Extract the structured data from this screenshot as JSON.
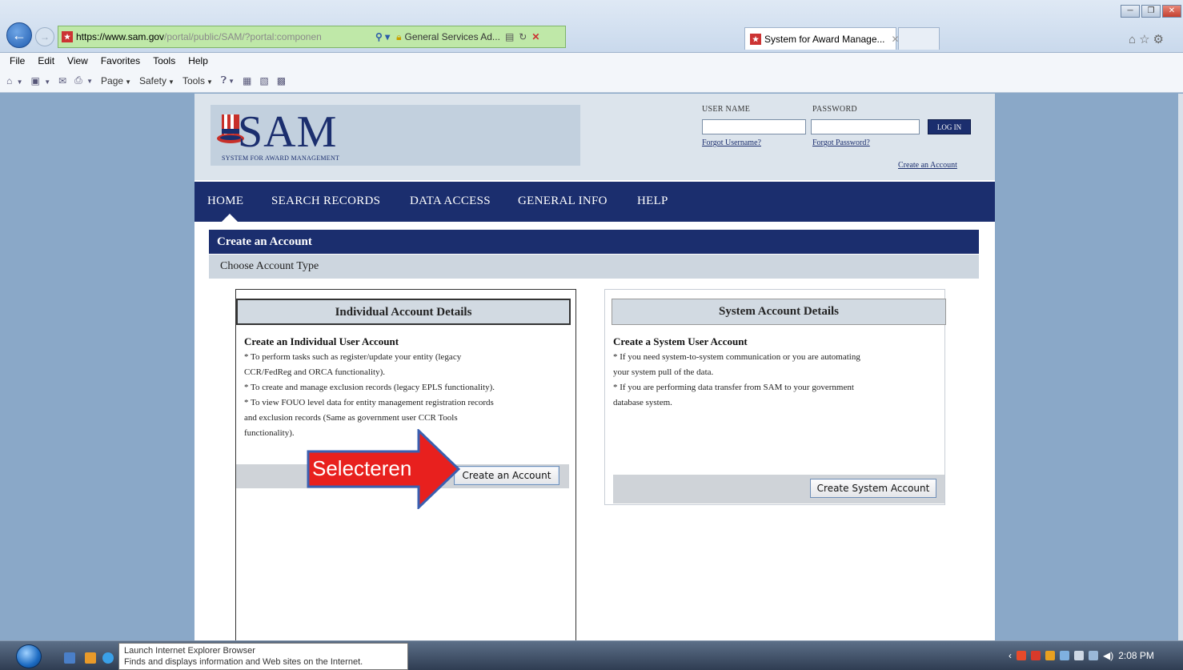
{
  "browser": {
    "address": {
      "url_host": "https://www.sam.gov",
      "url_path": "/portal/public/SAM/?portal:componen",
      "cert_owner": "General Services Ad...",
      "favicon": "SAM"
    },
    "tab_title": "System for Award Manage...",
    "menu": [
      "File",
      "Edit",
      "View",
      "Favorites",
      "Tools",
      "Help"
    ],
    "commands": {
      "page": "Page",
      "safety": "Safety",
      "tools": "Tools"
    },
    "window_controls": [
      "─",
      "❐",
      "✕"
    ]
  },
  "sam": {
    "logo_text": "SAM",
    "logo_subtitle": "SYSTEM FOR AWARD MANAGEMENT",
    "login": {
      "username_label": "USER NAME",
      "password_label": "PASSWORD",
      "username_value": "",
      "password_value": "",
      "login_button": "LOG IN",
      "forgot_username": "Forgot Username?",
      "forgot_password": "Forgot Password?",
      "create_account": "Create an Account"
    },
    "nav": [
      "HOME",
      "SEARCH RECORDS",
      "DATA ACCESS",
      "GENERAL INFO",
      "HELP"
    ],
    "section_title": "Create an Account",
    "section_subtitle": "Choose Account Type",
    "individual": {
      "heading": "Individual Account Details",
      "title": "Create an Individual User Account",
      "lines": [
        "* To perform tasks such as register/update your entity (legacy",
        "CCR/FedReg and ORCA functionality).",
        "* To create and manage exclusion records (legacy EPLS functionality).",
        "* To view FOUO level data for entity management registration records",
        "and exclusion records (Same as government user CCR Tools",
        "functionality)."
      ],
      "button": "Create an Account"
    },
    "system": {
      "heading": "System Account Details",
      "title": "Create a System User Account",
      "lines": [
        "* If you need system-to-system communication or you are automating",
        "your system pull of the data.",
        "* If you are performing data transfer from SAM to your government",
        "database system."
      ],
      "button": "Create System Account"
    }
  },
  "annotation": {
    "text": "Selecteren",
    "color": "#e8201e"
  },
  "taskbar": {
    "tooltip_title": "Launch Internet Explorer Browser",
    "tooltip_desc": "Finds and displays information and Web sites on the Internet.",
    "time": "2:08 PM"
  }
}
